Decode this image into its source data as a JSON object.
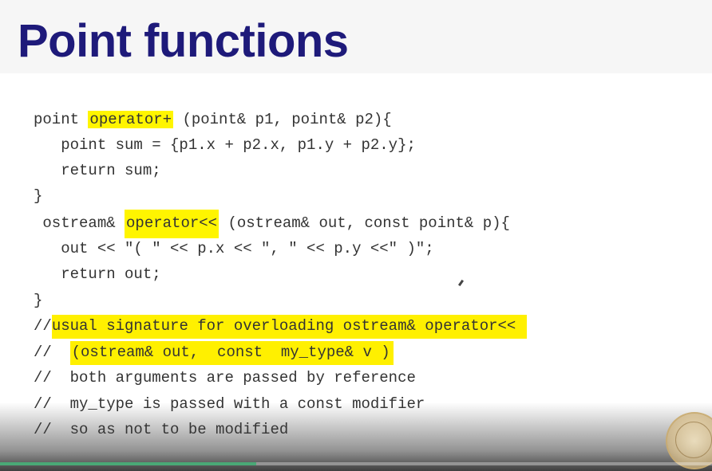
{
  "slide": {
    "title": "Point functions"
  },
  "code": {
    "line1_pre": "point ",
    "line1_hl": "operator+",
    "line1_post": " (point& p1, point& p2){",
    "line2": "   point sum = {p1.x + p2.x, p1.y + p2.y};",
    "line3": "   return sum;",
    "line4": "}",
    "line5_pre": " ostream& ",
    "line5_hl": "operator<<",
    "line5_post": " (ostream& out, const point& p){",
    "line6": "   out << \"( \" << p.x << \", \" << p.y <<\" )\";",
    "line7": "   return out;",
    "line8": "}",
    "line9_pre": "//",
    "line9_hl": "usual signature for overloading ostream& operator<<",
    "line10_pre": "//  ",
    "line10_hl": "(ostream& out,  const  my_type& v )",
    "line11": "//  both arguments are passed by reference",
    "line12": "//  my_type is passed with a const modifier",
    "line13": "//  so as not to be modified"
  },
  "player": {
    "progress_fraction": 0.36,
    "progress_color": "#4aa876"
  },
  "colors": {
    "title": "#1e1a7a",
    "highlight": "#fff500"
  }
}
